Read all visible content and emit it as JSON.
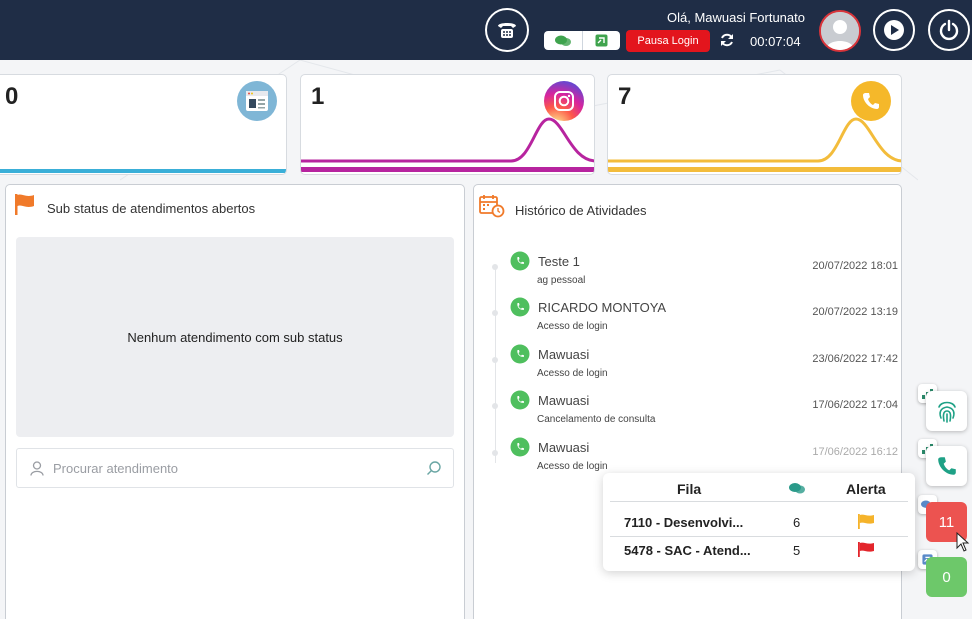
{
  "header": {
    "greeting": "Olá, Mawuasi Fortunato",
    "pause_label": "Pausa Login",
    "timer": "00:07:04",
    "icons": [
      "phone-icon",
      "chat-icon",
      "external-phone-icon",
      "refresh-icon",
      "avatar",
      "play-icon",
      "power-icon"
    ]
  },
  "stats": [
    {
      "value": "0",
      "icon": "web-icon",
      "color": "#3aafd8"
    },
    {
      "value": "1",
      "icon": "instagram-icon",
      "color": "#b7249f"
    },
    {
      "value": "7",
      "icon": "phone-icon",
      "color": "#f3bc3b"
    }
  ],
  "substatus": {
    "title": "Sub status de atendimentos abertos",
    "empty_text": "Nenhum atendimento com sub status",
    "search_placeholder": "Procurar atendimento"
  },
  "history": {
    "title": "Histórico de Atividades",
    "items": [
      {
        "name": "Teste 1",
        "desc": "ag pessoal",
        "date": "20/07/2022 18:01"
      },
      {
        "name": "RICARDO MONTOYA",
        "desc": "Acesso de login",
        "date": "20/07/2022 13:19"
      },
      {
        "name": "Mawuasi",
        "desc": "Acesso de login",
        "date": "23/06/2022 17:42"
      },
      {
        "name": "Mawuasi",
        "desc": "Cancelamento de consulta",
        "date": "17/06/2022 17:04"
      },
      {
        "name": "Mawuasi",
        "desc": "Acesso de login",
        "date": "17/06/2022 16:12"
      }
    ]
  },
  "side": {
    "chat_count": "11",
    "phone_count": "0"
  },
  "queue_popup": {
    "col_queue": "Fila",
    "col_alert": "Alerta",
    "rows": [
      {
        "queue": "7110 - Desenvolvi...",
        "count": "6",
        "flag_color": "#f5b32a"
      },
      {
        "queue": "5478 - SAC - Atend...",
        "count": "5",
        "flag_color": "#e3252b"
      }
    ]
  }
}
